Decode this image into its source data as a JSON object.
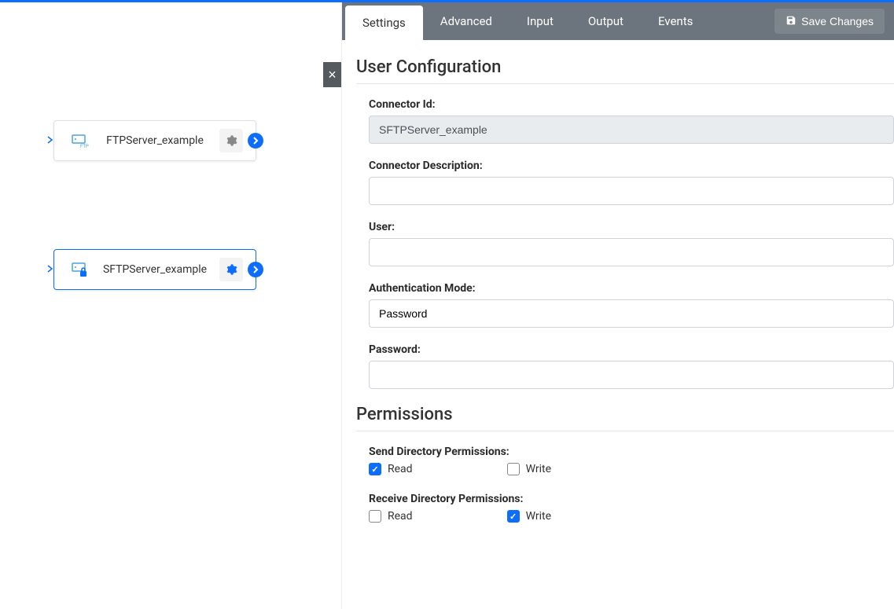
{
  "connectors": [
    {
      "label": "FTPServer_example",
      "selected": false
    },
    {
      "label": "SFTPServer_example",
      "selected": true
    }
  ],
  "tabs": [
    "Settings",
    "Advanced",
    "Input",
    "Output",
    "Events"
  ],
  "active_tab": "Settings",
  "save_button": "Save Changes",
  "user_config": {
    "heading": "User Configuration",
    "connector_id": {
      "label": "Connector Id:",
      "value": "SFTPServer_example"
    },
    "connector_description": {
      "label": "Connector Description:",
      "value": ""
    },
    "user": {
      "label": "User:",
      "value": ""
    },
    "auth_mode": {
      "label": "Authentication Mode:",
      "value": "Password"
    },
    "password": {
      "label": "Password:",
      "value": ""
    }
  },
  "permissions": {
    "heading": "Permissions",
    "send": {
      "label": "Send Directory Permissions:",
      "read": {
        "label": "Read",
        "checked": true
      },
      "write": {
        "label": "Write",
        "checked": false
      }
    },
    "receive": {
      "label": "Receive Directory Permissions:",
      "read": {
        "label": "Read",
        "checked": false
      },
      "write": {
        "label": "Write",
        "checked": true
      }
    }
  },
  "colors": {
    "accent": "#0d6efd",
    "tab_bg": "#6c757d"
  }
}
